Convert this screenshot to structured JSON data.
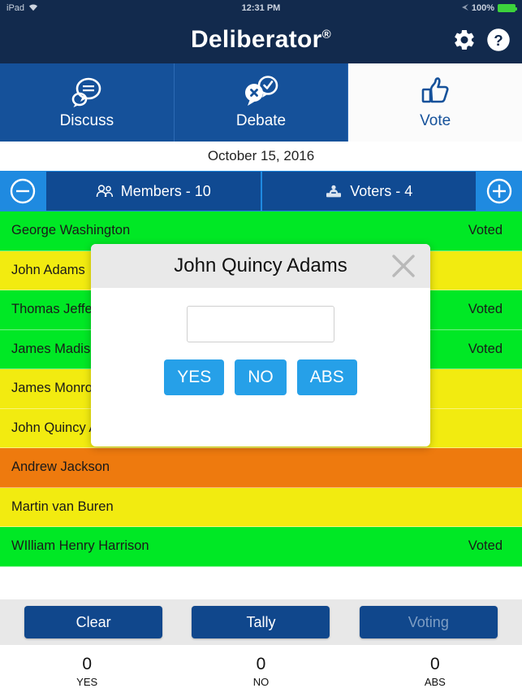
{
  "statusbar": {
    "device": "iPad",
    "wifi_icon": "wifi-icon",
    "time": "12:31 PM",
    "battery_percent": "100%",
    "battery_icon": "battery-full-icon",
    "location_icon": "location-arrow-icon"
  },
  "header": {
    "title": "Deliberator",
    "registered_mark": "®",
    "settings_icon": "gear-icon",
    "help_icon": "question-circle-icon"
  },
  "tabs": [
    {
      "label": "Discuss",
      "icon": "speech-bubbles-icon",
      "active": false
    },
    {
      "label": "Debate",
      "icon": "debate-bubbles-icon",
      "active": false
    },
    {
      "label": "Vote",
      "icon": "thumbs-up-icon",
      "active": true
    }
  ],
  "date": "October 15, 2016",
  "segment_bar": {
    "minus_icon": "minus-circle-icon",
    "plus_icon": "plus-circle-icon",
    "members": {
      "label": "Members - 10",
      "icon": "people-icon"
    },
    "voters": {
      "label": "Voters - 4",
      "icon": "ballot-box-icon"
    }
  },
  "members": [
    {
      "name": "George Washington",
      "status": "Voted",
      "color": "#00E825"
    },
    {
      "name": "John Adams",
      "status": "",
      "color": "#F2EB10"
    },
    {
      "name": "Thomas Jefferson",
      "status": "Voted",
      "color": "#00E825"
    },
    {
      "name": "James Madison",
      "status": "Voted",
      "color": "#00E825"
    },
    {
      "name": "James Monroe",
      "status": "",
      "color": "#F2EB10"
    },
    {
      "name": "John Quincy Adams",
      "status": "",
      "color": "#F2EB10"
    },
    {
      "name": "Andrew Jackson",
      "status": "",
      "color": "#EE7A0E"
    },
    {
      "name": "Martin van Buren",
      "status": "",
      "color": "#F2EB10"
    },
    {
      "name": "WIlliam Henry Harrison",
      "status": "Voted",
      "color": "#00E825"
    }
  ],
  "actions": {
    "clear_label": "Clear",
    "tally_label": "Tally",
    "voting_label": "Voting",
    "voting_disabled": true
  },
  "tallies": [
    {
      "count": "0",
      "label": "YES"
    },
    {
      "count": "0",
      "label": "NO"
    },
    {
      "count": "0",
      "label": "ABS"
    }
  ],
  "modal": {
    "title": "John Quincy Adams",
    "close_icon": "close-x-icon",
    "input_value": "",
    "input_placeholder": "",
    "buttons": [
      {
        "label": "YES"
      },
      {
        "label": "NO"
      },
      {
        "label": "ABS"
      }
    ]
  },
  "colors": {
    "navy": "#122A4D",
    "tab_blue": "#15519A",
    "segment_blue": "#1f8ae0",
    "segment_dark": "#104A92",
    "vote_blue": "#26A0E8",
    "green": "#00E825",
    "yellow": "#F2EB10",
    "orange": "#EE7A0E"
  }
}
